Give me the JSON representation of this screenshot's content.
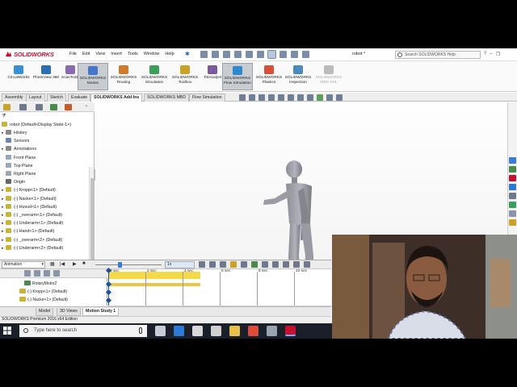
{
  "app": {
    "logo_text": "SOLIDWORKS",
    "document_title": "robot *",
    "menu": [
      "File",
      "Edit",
      "View",
      "Insert",
      "Tools",
      "Window",
      "Help"
    ],
    "help_search_placeholder": "Search SOLIDWORKS Help"
  },
  "commands": [
    {
      "label": "CircuitWorks",
      "active": false,
      "color": "#3a8fd6"
    },
    {
      "label": "PhotoView 360",
      "active": false,
      "color": "#2b6fb3"
    },
    {
      "label": "ScanTo3D",
      "active": false,
      "color": "#8a6bb0"
    },
    {
      "label": "SOLIDWORKS Motion",
      "active": true,
      "color": "#4477cc"
    },
    {
      "label": "SOLIDWORKS Routing",
      "active": false,
      "color": "#d07a2a"
    },
    {
      "label": "SOLIDWORKS Simulation",
      "active": false,
      "color": "#3b9e5a"
    },
    {
      "label": "SOLIDWORKS Toolbox",
      "active": false,
      "color": "#c9a227"
    },
    {
      "label": "TolAnalyst",
      "active": false,
      "color": "#7a5c9e"
    },
    {
      "label": "SOLIDWORKS Flow Simulation",
      "active": true,
      "color": "#2f88c9"
    },
    {
      "label": "SOLIDWORKS Plastics",
      "active": false,
      "color": "#d64f3b"
    },
    {
      "label": "SOLIDWORKS Inspection",
      "active": false,
      "color": "#4a8bbd"
    },
    {
      "label": "SOLIDWORKS MBD SNL",
      "active": false,
      "disabled": true,
      "color": "#bbbbbb"
    }
  ],
  "tabs": [
    "Assembly",
    "Layout",
    "Sketch",
    "Evaluate",
    "SOLIDWORKS Add-Ins",
    "SOLIDWORKS MBD",
    "Flow Simulation"
  ],
  "active_tab": "SOLIDWORKS Add-Ins",
  "feature_tree": {
    "root": "robot  (Default<Display State-1>)",
    "items": [
      {
        "label": "History",
        "icon_color": "#8a8a8a",
        "expander": "▸"
      },
      {
        "label": "Sensors",
        "icon_color": "#6a86b8",
        "expander": ""
      },
      {
        "label": "Annotations",
        "icon_color": "#8a8a8a",
        "expander": "▸"
      },
      {
        "label": "Front Plane",
        "icon_color": "#9aa7bb",
        "expander": ""
      },
      {
        "label": "Top Plane",
        "icon_color": "#9aa7bb",
        "expander": ""
      },
      {
        "label": "Right Plane",
        "icon_color": "#9aa7bb",
        "expander": ""
      },
      {
        "label": "Origin",
        "icon_color": "#666666",
        "expander": ""
      },
      {
        "label": "(-) Kropp<1> (Default)",
        "icon_color": "#c9b43a",
        "expander": "▸"
      },
      {
        "label": "(-) Nacke<1> (Default)",
        "icon_color": "#c9b43a",
        "expander": "▸"
      },
      {
        "label": "(-) Huvud<1> (Default)",
        "icon_color": "#c9b43a",
        "expander": "▸"
      },
      {
        "label": "(-) _overarm<1> (Default)",
        "icon_color": "#c9b43a",
        "expander": "▸"
      },
      {
        "label": "(-) Underarm<1> (Default)",
        "icon_color": "#c9b43a",
        "expander": "▸"
      },
      {
        "label": "(-) Hand<1> (Default)",
        "icon_color": "#c9b43a",
        "expander": "▸"
      },
      {
        "label": "(-) _overarm<2> (Default)",
        "icon_color": "#c9b43a",
        "expander": "▸"
      },
      {
        "label": "(-) Underarm<2> (Default)",
        "icon_color": "#c9b43a",
        "expander": "▸"
      }
    ]
  },
  "motion_manager": {
    "study_type": "Animation",
    "playback_speed": "1x",
    "time_labels": [
      "0 sec",
      "2 sec",
      "4 sec",
      "6 sec",
      "8 sec",
      "10 sec"
    ],
    "rows": [
      {
        "label": "RotaryMotor2",
        "indent": 30
      },
      {
        "label": "(-) Kropp<1> (Default)",
        "indent": 24
      },
      {
        "label": "(-) Nacke<1> (Default)",
        "indent": 24
      }
    ]
  },
  "bottom_tabs": [
    "Model",
    "3D Views",
    "Motion Study 1"
  ],
  "active_bottom_tab": "Motion Study 1",
  "status_text": "SOLIDWORKS Premium 2016 x64 Edition",
  "taskbar": {
    "search_placeholder": "Type here to search",
    "apps": [
      {
        "name": "task-view",
        "color": "#c7ccd6"
      },
      {
        "name": "edge",
        "color": "#2d7ad6"
      },
      {
        "name": "store",
        "color": "#d8d8d8"
      },
      {
        "name": "mail",
        "color": "#d0d0d0"
      },
      {
        "name": "file-explorer",
        "color": "#e8c24a"
      },
      {
        "name": "chrome",
        "color": "#dd4b39"
      },
      {
        "name": "app-circle",
        "color": "#9aa4b1"
      },
      {
        "name": "solidworks",
        "color": "#c8102e",
        "active": true
      }
    ]
  },
  "colors": {
    "brand_red": "#c8102e",
    "accent_blue": "#3a7bd5",
    "timeline_yellow": "#f4d94a"
  }
}
